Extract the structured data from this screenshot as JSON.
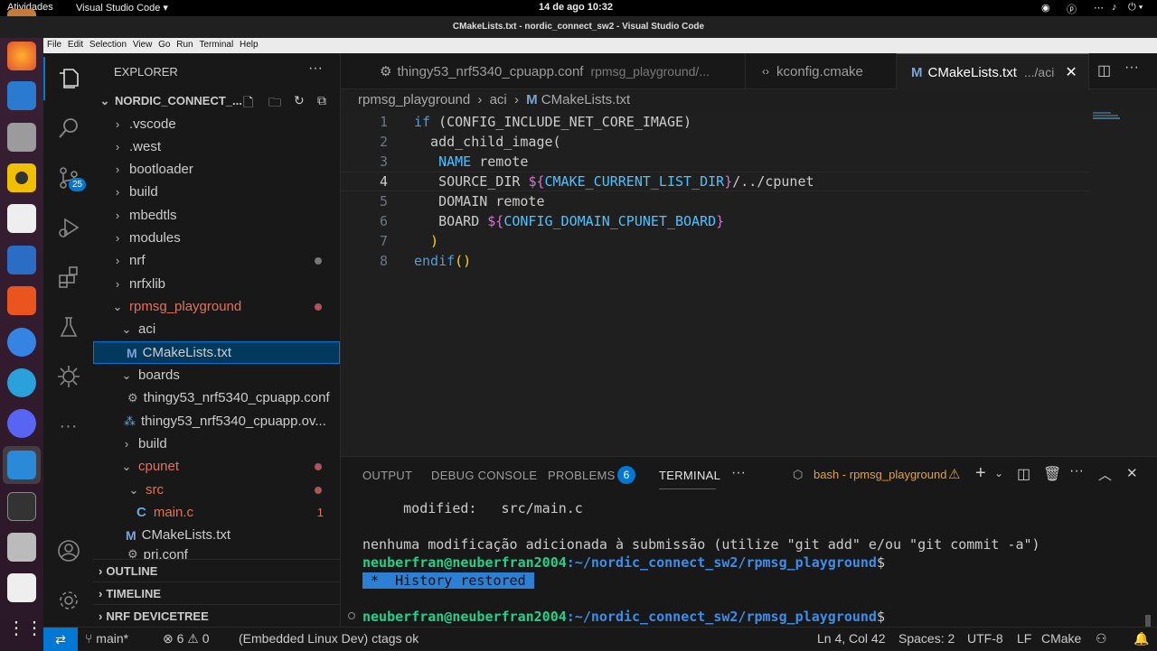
{
  "system": {
    "activities": "Atividades",
    "app_menu": "Visual Studio Code ▾",
    "clock": "14 de ago  10:32"
  },
  "window": {
    "title": "CMakeLists.txt - nordic_connect_sw2 - Visual Studio Code"
  },
  "menu": [
    "File",
    "Edit",
    "Selection",
    "View",
    "Go",
    "Run",
    "Terminal",
    "Help"
  ],
  "activity": {
    "scm_badge": "25"
  },
  "explorer": {
    "title": "EXPLORER",
    "root": "NORDIC_CONNECT_...",
    "items": [
      {
        "label": ".vscode"
      },
      {
        "label": ".west"
      },
      {
        "label": "bootloader"
      },
      {
        "label": "build"
      },
      {
        "label": "mbedtls"
      },
      {
        "label": "modules"
      },
      {
        "label": "nrf"
      },
      {
        "label": "nrfxlib"
      },
      {
        "label": "rpmsg_playground"
      },
      {
        "label": "aci"
      },
      {
        "label": "CMakeLists.txt"
      },
      {
        "label": "boards"
      },
      {
        "label": "thingy53_nrf5340_cpuapp.conf"
      },
      {
        "label": "thingy53_nrf5340_cpuapp.ov..."
      },
      {
        "label": "build"
      },
      {
        "label": "cpunet"
      },
      {
        "label": "src"
      },
      {
        "label": "main.c",
        "badge": "1"
      },
      {
        "label": "CMakeLists.txt"
      },
      {
        "label": "prj.conf"
      }
    ],
    "sections": [
      "OUTLINE",
      "TIMELINE",
      "NRF DEVICETREE"
    ]
  },
  "tabs": [
    {
      "label": "thingy53_nrf5340_cpuapp.conf",
      "desc": "rpmsg_playground/..."
    },
    {
      "label": "kconfig.cmake",
      "desc": ""
    },
    {
      "label": "CMakeLists.txt",
      "desc": ".../aci"
    }
  ],
  "breadcrumb": [
    "rpmsg_playground",
    "aci",
    "CMakeLists.txt"
  ],
  "code": {
    "line_numbers": [
      "1",
      "2",
      "3",
      "4",
      "5",
      "6",
      "7",
      "8"
    ],
    "l1_kw": "if",
    "l1_a": " (CONFIG_INCLUDE_NET_CORE_IMAGE)",
    "l2": "  add_child_image(",
    "l3_a": "   NAME",
    "l3_b": " remote",
    "l4_a": "   SOURCE_DIR ",
    "l4_b": "${",
    "l4_c": "CMAKE_CURRENT_LIST_DIR",
    "l4_d": "}",
    "l4_e": "/../cpunet",
    "l5": "   DOMAIN remote",
    "l6_a": "   BOARD ",
    "l6_b": "${",
    "l6_c": "CONFIG_DOMAIN_CPUNET_BOARD",
    "l6_d": "}",
    "l7": "  )",
    "l8_kw": "endif",
    "l8_p": "()"
  },
  "panel": {
    "tabs": [
      "OUTPUT",
      "DEBUG CONSOLE",
      "PROBLEMS",
      "TERMINAL"
    ],
    "problems_count": "6",
    "terminal_name": "bash - rpmsg_playground",
    "lines": {
      "l1": "     modified:   src/main.c",
      "l2": "nenhuma modificação adicionada à submissão (utilize \"git add\" e/ou \"git commit -a\")",
      "user": "neuberfran@neuberfran2004",
      "path": ":~/nordic_connect_sw2/rpmsg_playground",
      "dollar": "$",
      "history": " *  History restored "
    }
  },
  "status": {
    "branch": "main*",
    "errors": "6",
    "warnings": "0",
    "task": "(Embedded Linux Dev) ctags ok",
    "position": "Ln 4, Col 42",
    "spaces": "Spaces: 2",
    "encoding": "UTF-8",
    "eol": "LF",
    "language": "CMake"
  },
  "colors": {
    "accent": "#0078d4",
    "modified": "#e2725b",
    "git_dot": "#a9555b"
  }
}
